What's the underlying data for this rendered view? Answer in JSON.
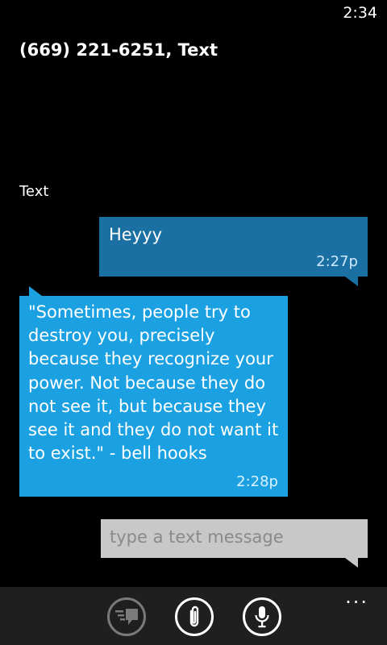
{
  "status_bar": {
    "time": "2:34"
  },
  "header": {
    "title": "(669) 221-6251, Text"
  },
  "conversation": {
    "section_label": "Text",
    "messages": [
      {
        "direction": "sent",
        "text": "Heyyy",
        "time": "2:27p",
        "color": "#1a6fa3"
      },
      {
        "direction": "received",
        "text": "\"Sometimes, people try to destroy you, precisely because they recognize your power. Not because they do not see it, but because they see it and they do not want it to exist.\" - bell hooks",
        "time": "2:28p",
        "color": "#1ba1e2"
      }
    ]
  },
  "compose": {
    "placeholder": "type a text message"
  },
  "app_bar": {
    "buttons": [
      {
        "name": "send",
        "icon": "send-icon",
        "enabled": false
      },
      {
        "name": "attach",
        "icon": "paperclip-icon",
        "enabled": true
      },
      {
        "name": "voice",
        "icon": "microphone-icon",
        "enabled": true
      }
    ],
    "more_label": "..."
  }
}
